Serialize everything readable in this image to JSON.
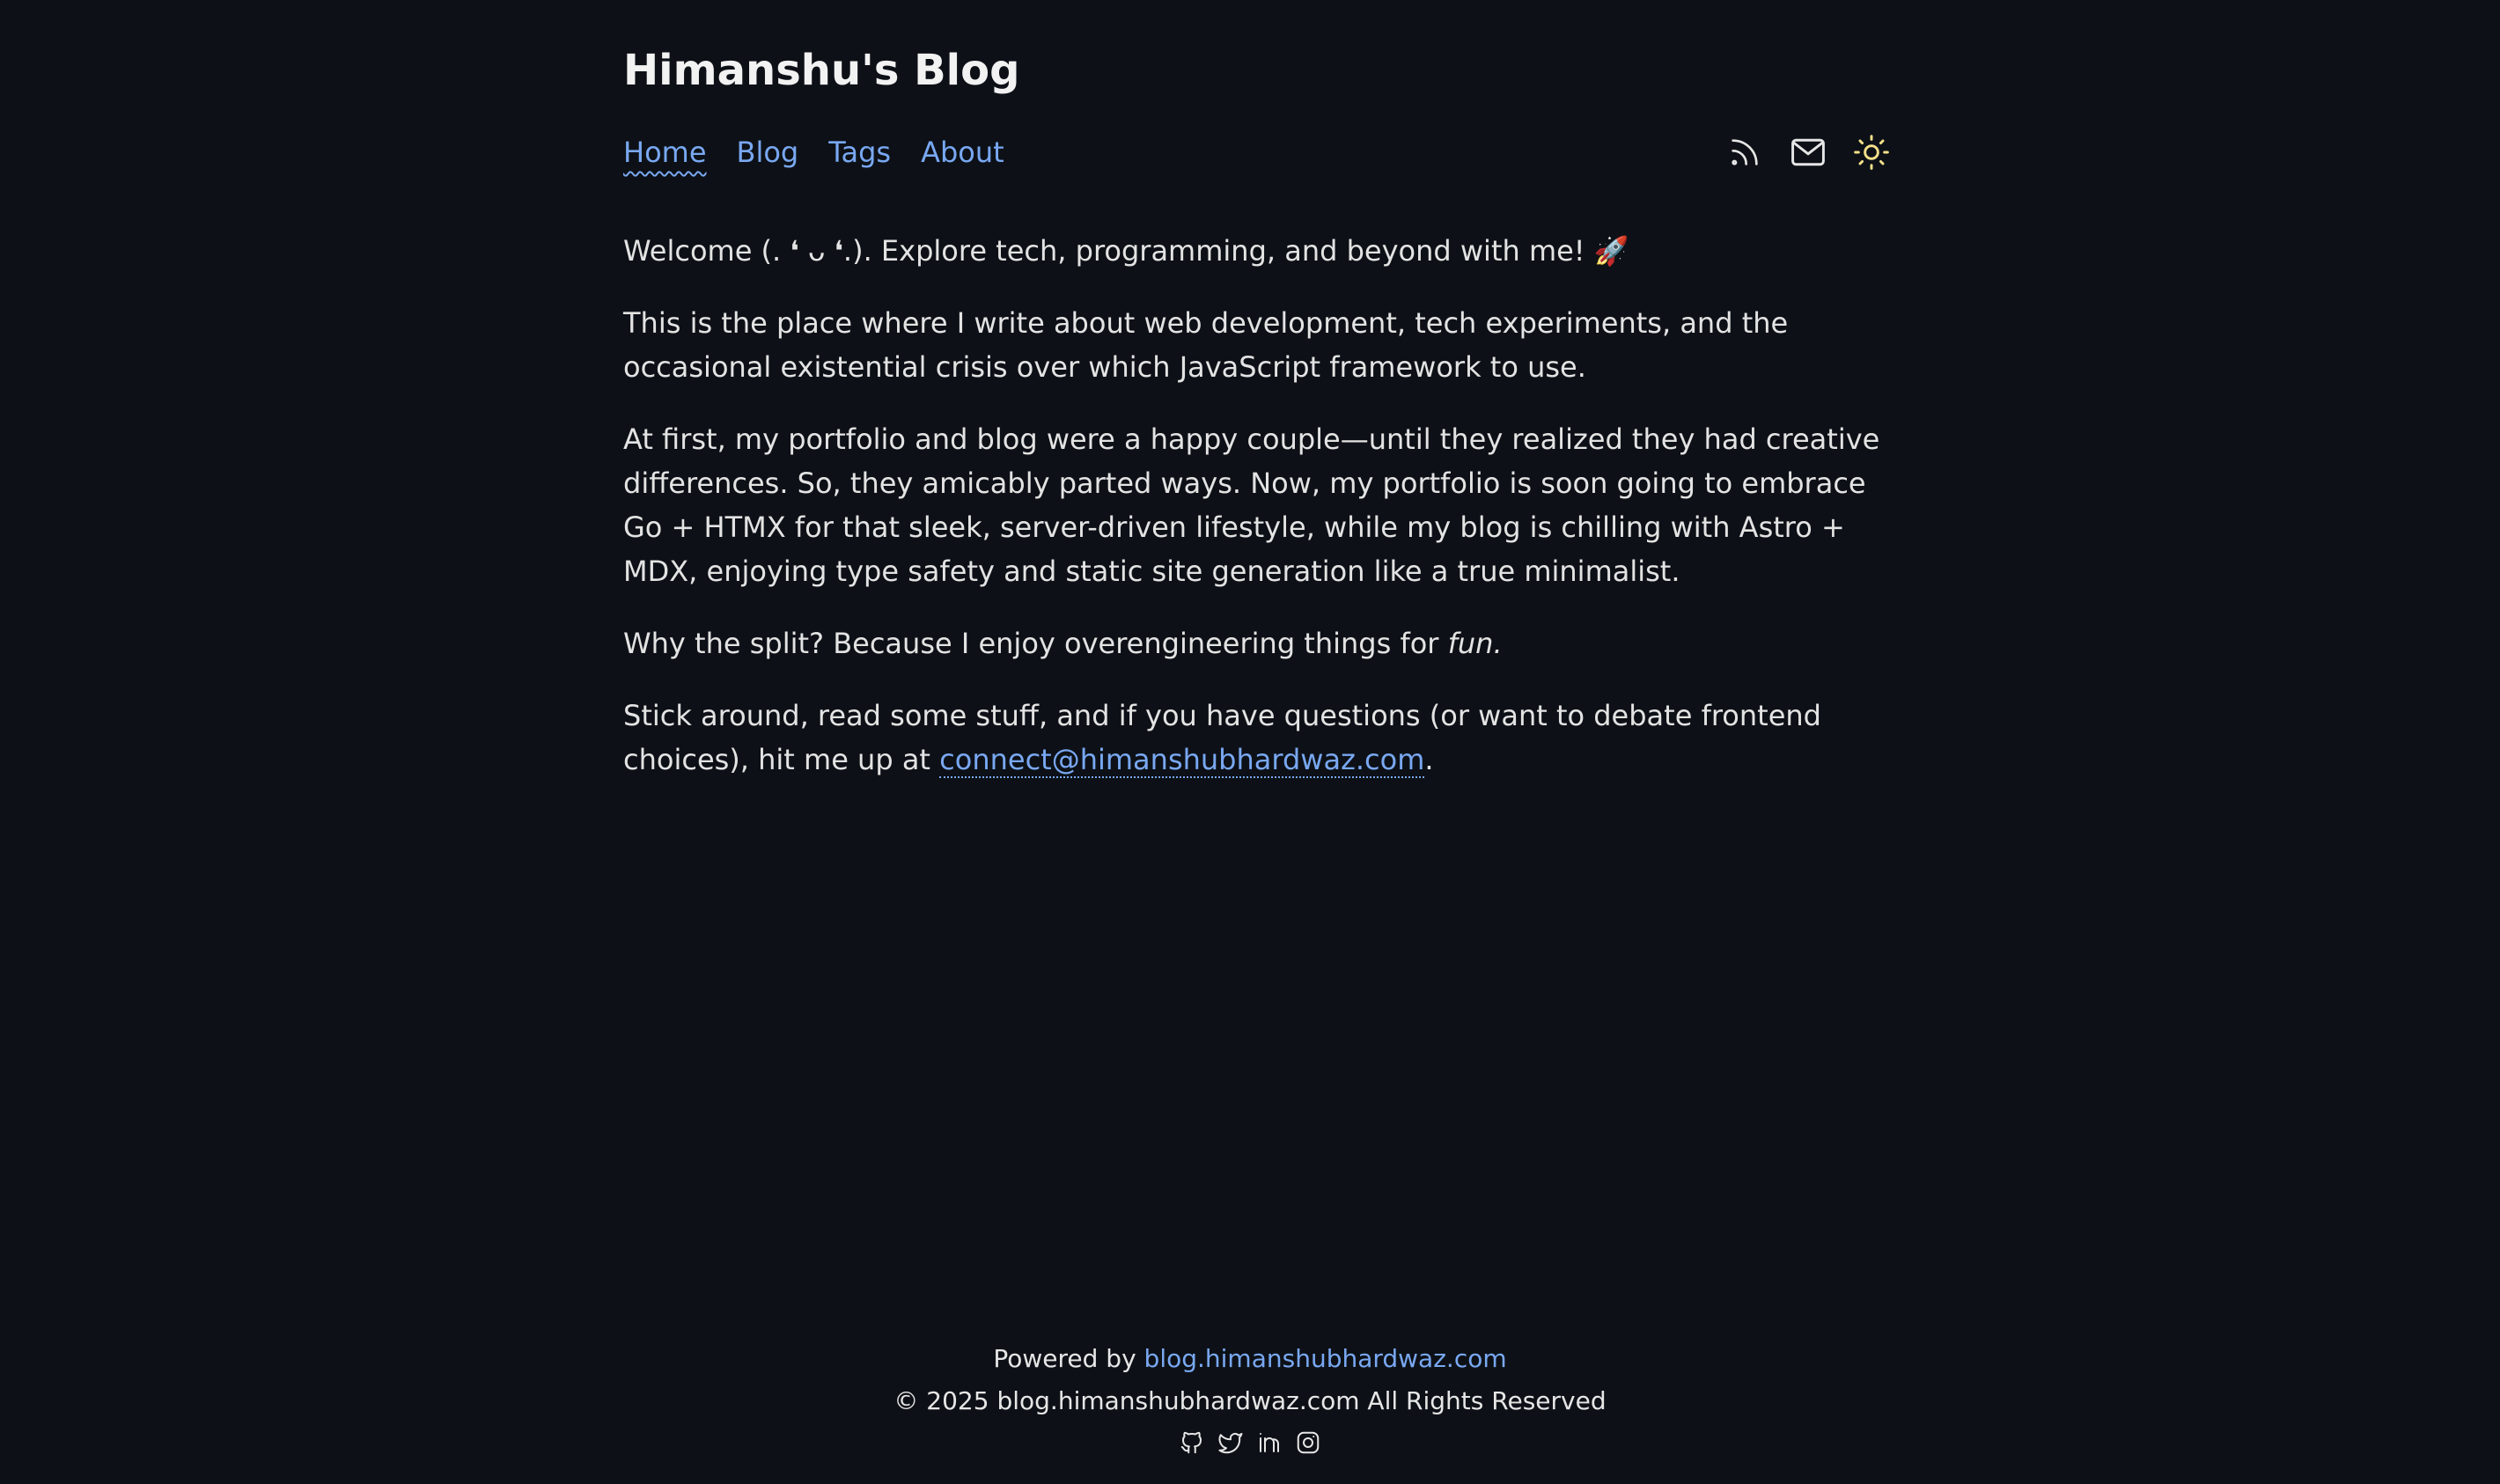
{
  "site": {
    "title": "Himanshu's Blog"
  },
  "nav": {
    "items": [
      {
        "label": "Home",
        "active": true
      },
      {
        "label": "Blog",
        "active": false
      },
      {
        "label": "Tags",
        "active": false
      },
      {
        "label": "About",
        "active": false
      }
    ],
    "icons": [
      "rss-icon",
      "mail-icon",
      "sun-icon"
    ]
  },
  "content": {
    "intro": "Welcome (. ❛ ᴗ ❛.). Explore tech, programming, and beyond with me! 🚀",
    "para1": "This is the place where I write about web development, tech experiments, and the occasional existential crisis over which JavaScript framework to use.",
    "para2": "At first, my portfolio and blog were a happy couple—until they realized they had creative differences. So, they amicably parted ways. Now, my portfolio is soon going to embrace Go + HTMX for that sleek, server-driven lifestyle, while my blog is chilling with Astro + MDX, enjoying type safety and static site generation like a true minimalist.",
    "para3_before": "Why the split? Because I enjoy overengineering things for ",
    "para3_em": "fun.",
    "para4_before": "Stick around, read some stuff, and if you have questions (or want to debate frontend choices), hit me up at ",
    "para4_email": "connect@himanshubhardwaz.com",
    "para4_after": "."
  },
  "footer": {
    "powered_label": "Powered by ",
    "powered_link": "blog.himanshubhardwaz.com",
    "copyright": "© 2025 blog.himanshubhardwaz.com All Rights Reserved",
    "social_icons": [
      "github-icon",
      "twitter-icon",
      "linkedin-icon",
      "instagram-icon"
    ]
  },
  "colors": {
    "background": "#0d1117",
    "text": "#e6e6e6",
    "link": "#79a8f2",
    "sun": "#f5e08a"
  }
}
